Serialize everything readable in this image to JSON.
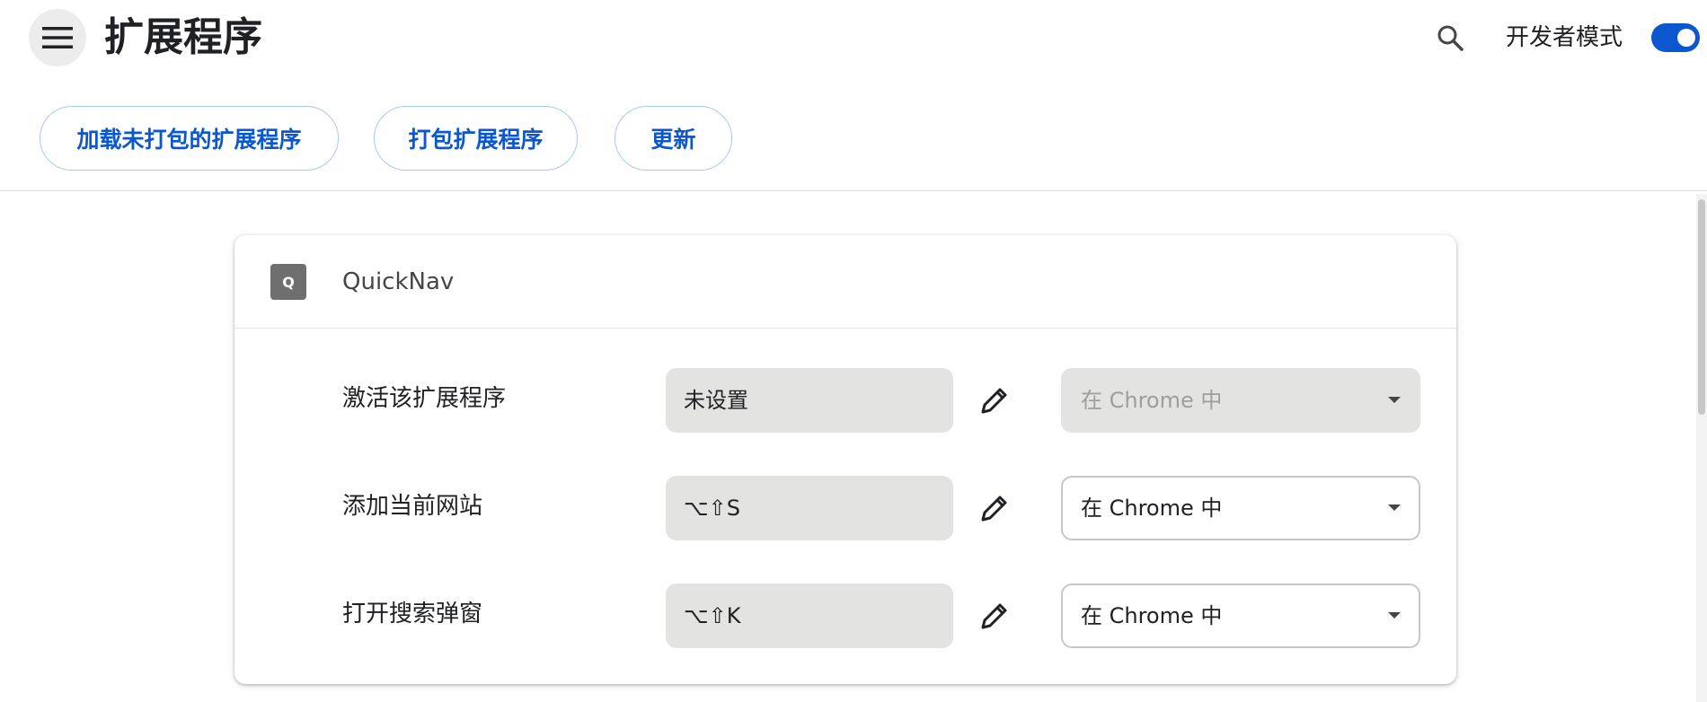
{
  "header": {
    "title": "扩展程序",
    "developer_mode_label": "开发者模式",
    "developer_mode_on": true,
    "icons": {
      "menu": "menu-icon",
      "search": "search-icon"
    }
  },
  "toolbar": {
    "load_unpacked": "加载未打包的扩展程序",
    "pack_extension": "打包扩展程序",
    "update": "更新"
  },
  "extension": {
    "icon_letter": "Q",
    "name": "QuickNav",
    "commands": [
      {
        "label": "激活该扩展程序",
        "shortcut": "未设置",
        "scope": "在 Chrome 中",
        "scope_disabled": true
      },
      {
        "label": "添加当前网站",
        "shortcut": "⌥⇧S",
        "scope": "在 Chrome 中",
        "scope_disabled": false
      },
      {
        "label": "打开搜索弹窗",
        "shortcut": "⌥⇧K",
        "scope": "在 Chrome 中",
        "scope_disabled": false
      }
    ]
  },
  "colors": {
    "accent": "#0b57d0",
    "button_border": "#a8c7fa",
    "field_bg": "#e3e3e1",
    "divider": "#dadce0"
  }
}
